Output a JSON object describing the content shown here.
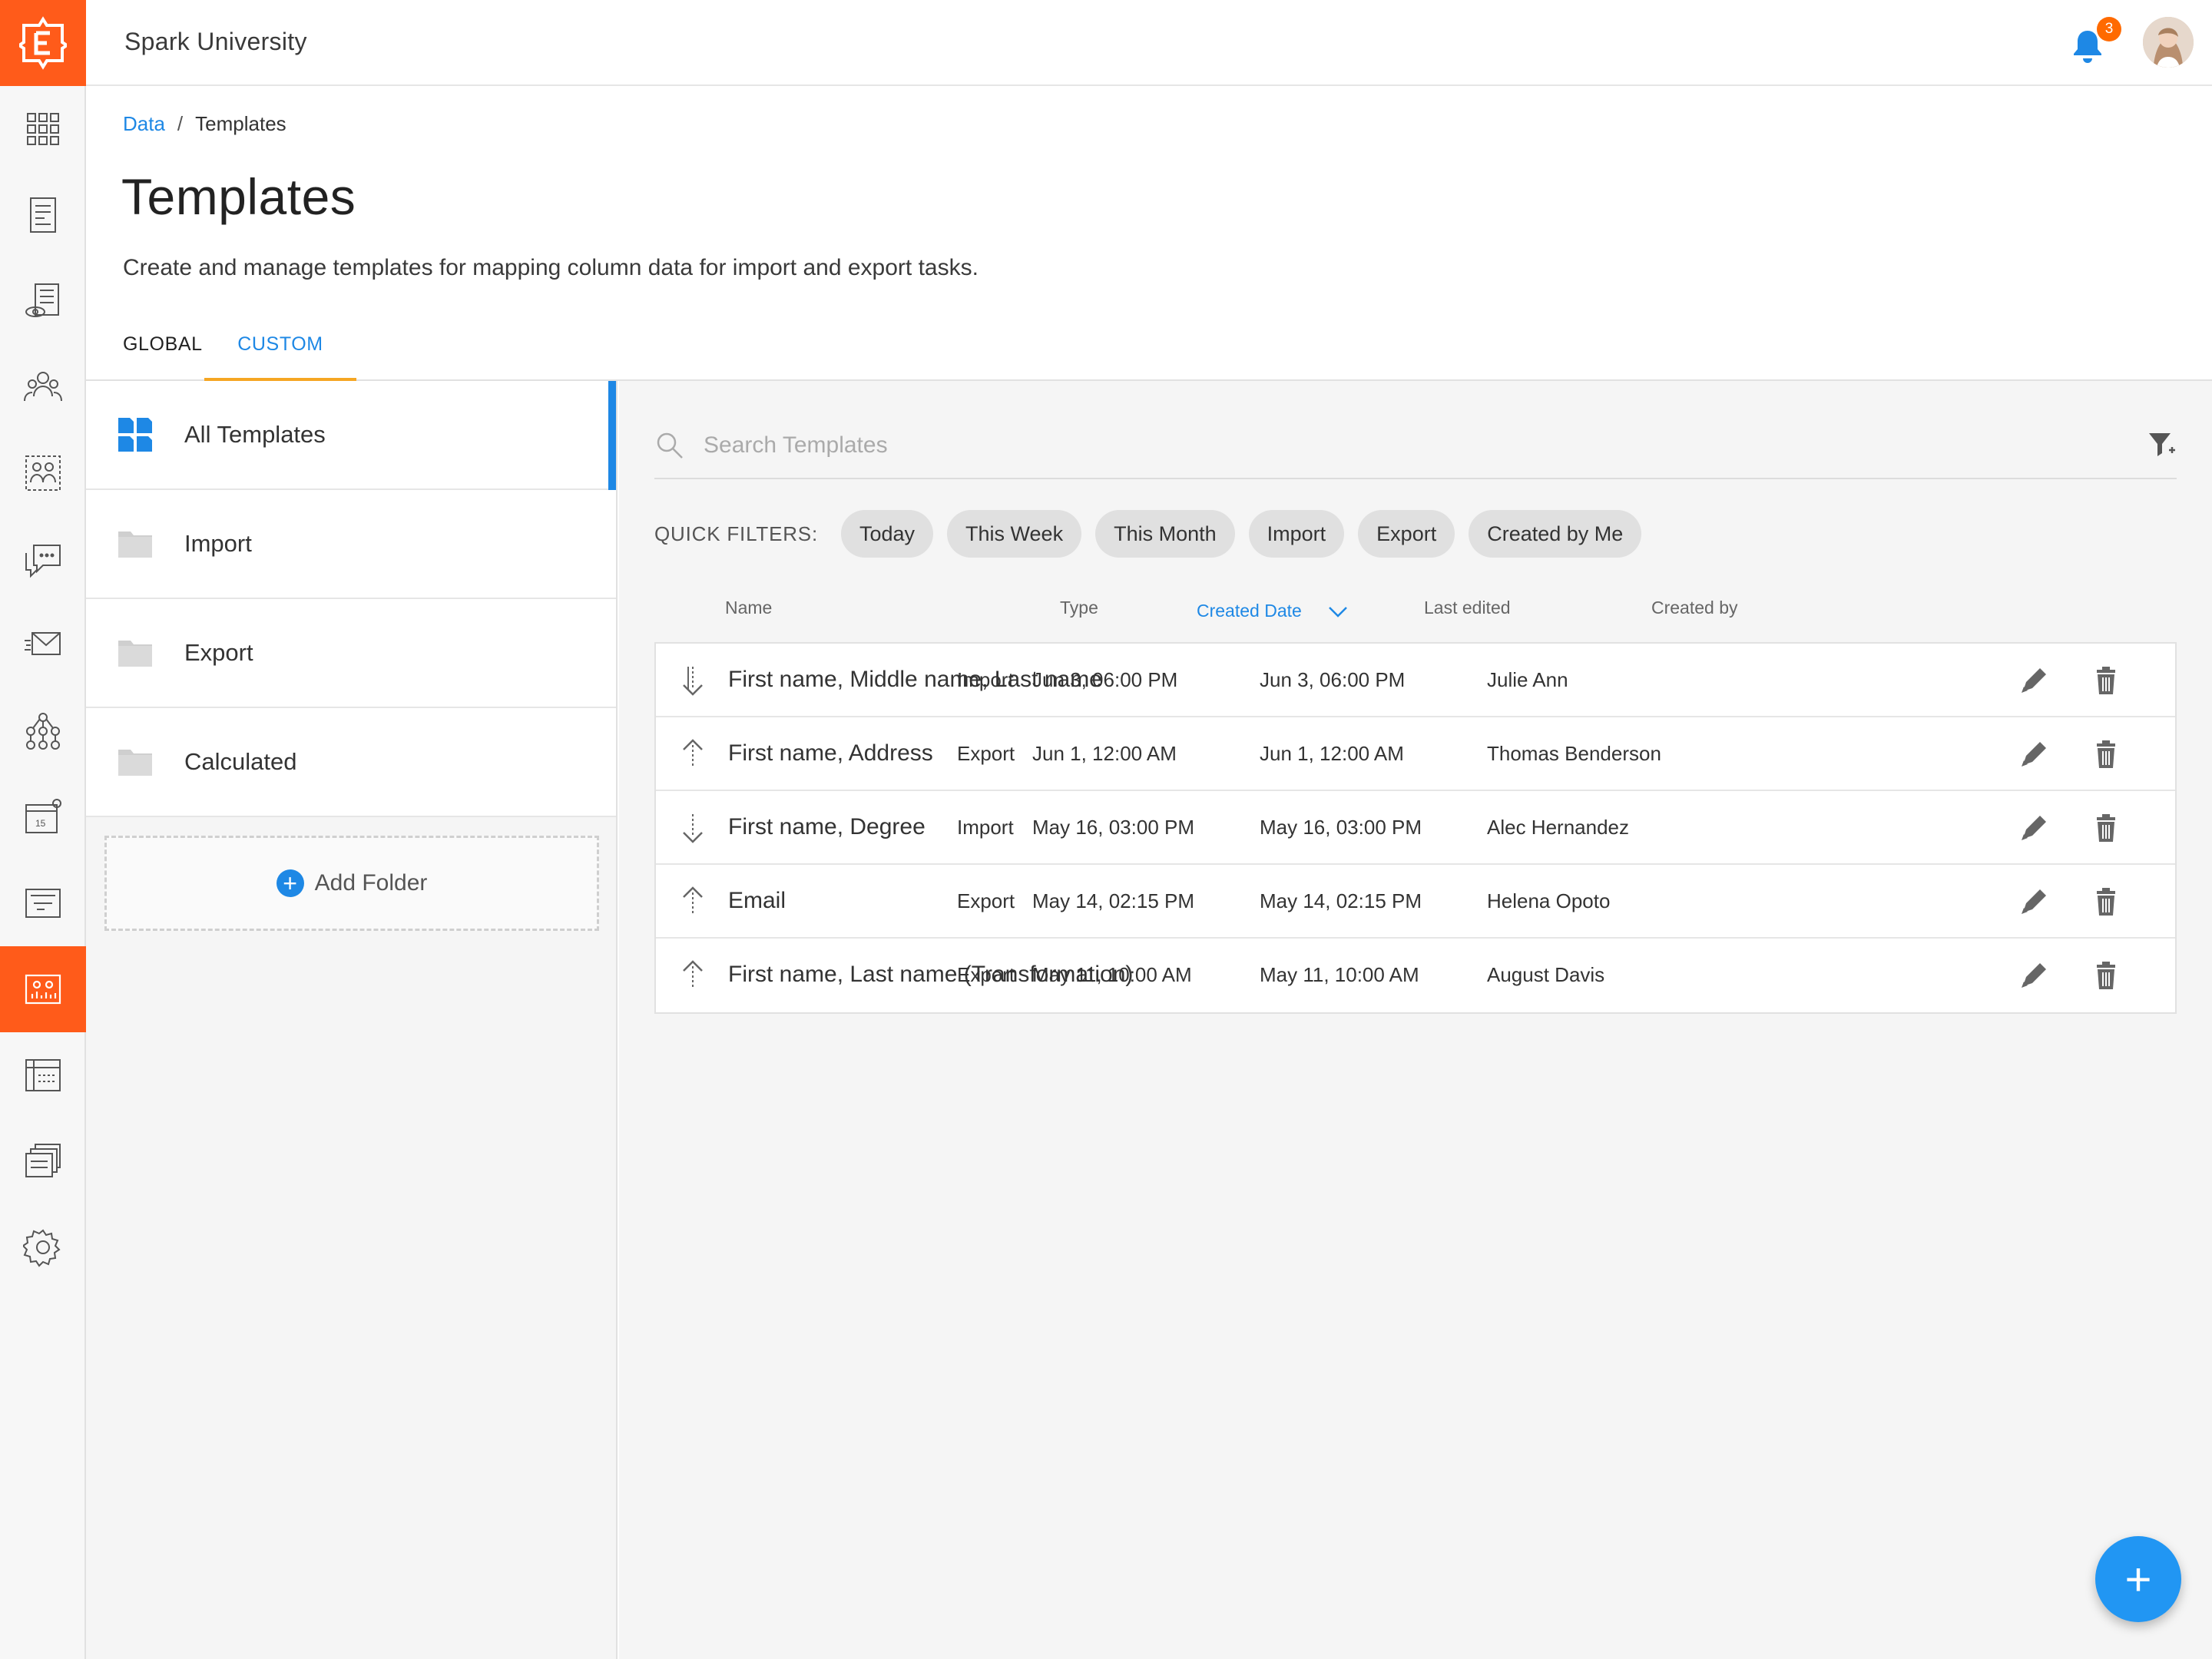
{
  "app": {
    "title": "Spark University",
    "notification_count": "3",
    "accent": "#ff5b1a",
    "link_color": "#1e88e5"
  },
  "breadcrumb": {
    "parent": "Data",
    "separator": "/",
    "current": "Templates"
  },
  "page": {
    "title": "Templates",
    "description": "Create and manage templates for mapping column data for import and export tasks."
  },
  "tabs": [
    {
      "label": "GLOBAL",
      "active": false
    },
    {
      "label": "CUSTOM",
      "active": true
    }
  ],
  "folders": [
    {
      "label": "All Templates",
      "icon": "grid-icon",
      "active": true
    },
    {
      "label": "Import",
      "icon": "folder-icon",
      "active": false
    },
    {
      "label": "Export",
      "icon": "folder-icon",
      "active": false
    },
    {
      "label": "Calculated",
      "icon": "folder-icon",
      "active": false
    }
  ],
  "add_folder_label": "Add Folder",
  "search": {
    "placeholder": "Search Templates"
  },
  "quick_filters": {
    "label": "QUICK FILTERS:",
    "chips": [
      "Today",
      "This Week",
      "This Month",
      "Import",
      "Export",
      "Created by Me"
    ]
  },
  "table": {
    "headers": {
      "name": "Name",
      "type": "Type",
      "created": "Created Date",
      "edited": "Last edited",
      "created_by": "Created by"
    },
    "sorted_column": "created",
    "rows": [
      {
        "direction": "import",
        "name": "First name, Middle name, Last name",
        "type": "Import",
        "created": "Jun 3, 06:00 PM",
        "edited": "Jun 3, 06:00 PM",
        "created_by": "Julie Ann"
      },
      {
        "direction": "export",
        "name": "First name, Address",
        "type": "Export",
        "created": "Jun 1, 12:00 AM",
        "edited": "Jun 1, 12:00 AM",
        "created_by": "Thomas Benderson"
      },
      {
        "direction": "import",
        "name": "First name, Degree",
        "type": "Import",
        "created": "May 16, 03:00 PM",
        "edited": "May 16, 03:00 PM",
        "created_by": "Alec Hernandez"
      },
      {
        "direction": "export",
        "name": "Email",
        "type": "Export",
        "created": "May 14, 02:15 PM",
        "edited": "May 14, 02:15 PM",
        "created_by": "Helena Opoto"
      },
      {
        "direction": "export",
        "name": "First name, Last name (Transformation)",
        "type": "Export",
        "created": "May 11, 10:00 AM",
        "edited": "May 11, 10:00 AM",
        "created_by": "August Davis"
      }
    ]
  },
  "fab_label": "+"
}
